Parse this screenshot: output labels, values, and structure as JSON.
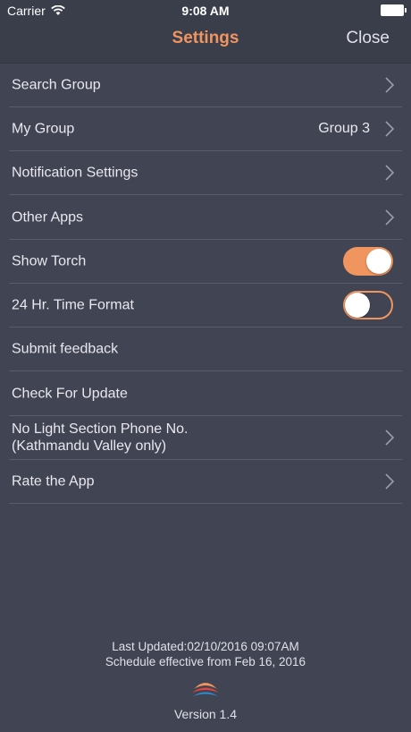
{
  "status_bar": {
    "carrier": "Carrier",
    "time": "9:08 AM"
  },
  "nav": {
    "title": "Settings",
    "close_label": "Close"
  },
  "colors": {
    "accent": "#f0955f",
    "background": "#414452"
  },
  "settings": {
    "search_group": "Search Group",
    "my_group": "My Group",
    "my_group_value": "Group 3",
    "notification_settings": "Notification Settings",
    "other_apps": "Other Apps",
    "show_torch": "Show Torch",
    "show_torch_on": true,
    "time_format": "24 Hr. Time Format",
    "time_format_on": false,
    "submit_feedback": "Submit feedback",
    "check_update": "Check For Update",
    "no_light_line1": "No Light Section Phone No.",
    "no_light_line2": "(Kathmandu Valley only)",
    "rate_app": "Rate the App"
  },
  "footer": {
    "last_updated": "Last Updated:02/10/2016 09:07AM",
    "schedule": "Schedule effective from Feb 16, 2016",
    "version": "Version 1.4"
  }
}
